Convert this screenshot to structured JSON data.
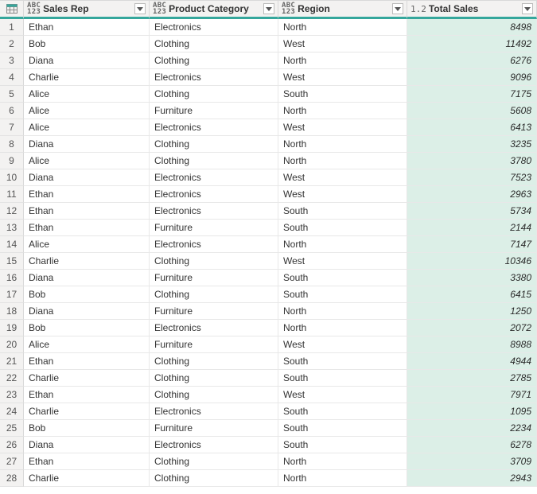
{
  "columns": [
    {
      "label": "Sales Rep",
      "type_top": "ABC",
      "type_bot": "123",
      "kind": "text"
    },
    {
      "label": "Product Category",
      "type_top": "ABC",
      "type_bot": "123",
      "kind": "text"
    },
    {
      "label": "Region",
      "type_top": "ABC",
      "type_bot": "123",
      "kind": "text"
    },
    {
      "label": "Total Sales",
      "type_num": "1.2",
      "kind": "num"
    }
  ],
  "rows": [
    {
      "n": "1",
      "rep": "Ethan",
      "cat": "Electronics",
      "reg": "North",
      "val": "8498"
    },
    {
      "n": "2",
      "rep": "Bob",
      "cat": "Clothing",
      "reg": "West",
      "val": "11492"
    },
    {
      "n": "3",
      "rep": "Diana",
      "cat": "Clothing",
      "reg": "North",
      "val": "6276"
    },
    {
      "n": "4",
      "rep": "Charlie",
      "cat": "Electronics",
      "reg": "West",
      "val": "9096"
    },
    {
      "n": "5",
      "rep": "Alice",
      "cat": "Clothing",
      "reg": "South",
      "val": "7175"
    },
    {
      "n": "6",
      "rep": "Alice",
      "cat": "Furniture",
      "reg": "North",
      "val": "5608"
    },
    {
      "n": "7",
      "rep": "Alice",
      "cat": "Electronics",
      "reg": "West",
      "val": "6413"
    },
    {
      "n": "8",
      "rep": "Diana",
      "cat": "Clothing",
      "reg": "North",
      "val": "3235"
    },
    {
      "n": "9",
      "rep": "Alice",
      "cat": "Clothing",
      "reg": "North",
      "val": "3780"
    },
    {
      "n": "10",
      "rep": "Diana",
      "cat": "Electronics",
      "reg": "West",
      "val": "7523"
    },
    {
      "n": "11",
      "rep": "Ethan",
      "cat": "Electronics",
      "reg": "West",
      "val": "2963"
    },
    {
      "n": "12",
      "rep": "Ethan",
      "cat": "Electronics",
      "reg": "South",
      "val": "5734"
    },
    {
      "n": "13",
      "rep": "Ethan",
      "cat": "Furniture",
      "reg": "South",
      "val": "2144"
    },
    {
      "n": "14",
      "rep": "Alice",
      "cat": "Electronics",
      "reg": "North",
      "val": "7147"
    },
    {
      "n": "15",
      "rep": "Charlie",
      "cat": "Clothing",
      "reg": "West",
      "val": "10346"
    },
    {
      "n": "16",
      "rep": "Diana",
      "cat": "Furniture",
      "reg": "South",
      "val": "3380"
    },
    {
      "n": "17",
      "rep": "Bob",
      "cat": "Clothing",
      "reg": "South",
      "val": "6415"
    },
    {
      "n": "18",
      "rep": "Diana",
      "cat": "Furniture",
      "reg": "North",
      "val": "1250"
    },
    {
      "n": "19",
      "rep": "Bob",
      "cat": "Electronics",
      "reg": "North",
      "val": "2072"
    },
    {
      "n": "20",
      "rep": "Alice",
      "cat": "Furniture",
      "reg": "West",
      "val": "8988"
    },
    {
      "n": "21",
      "rep": "Ethan",
      "cat": "Clothing",
      "reg": "South",
      "val": "4944"
    },
    {
      "n": "22",
      "rep": "Charlie",
      "cat": "Clothing",
      "reg": "South",
      "val": "2785"
    },
    {
      "n": "23",
      "rep": "Ethan",
      "cat": "Clothing",
      "reg": "West",
      "val": "7971"
    },
    {
      "n": "24",
      "rep": "Charlie",
      "cat": "Electronics",
      "reg": "South",
      "val": "1095"
    },
    {
      "n": "25",
      "rep": "Bob",
      "cat": "Furniture",
      "reg": "South",
      "val": "2234"
    },
    {
      "n": "26",
      "rep": "Diana",
      "cat": "Electronics",
      "reg": "South",
      "val": "6278"
    },
    {
      "n": "27",
      "rep": "Ethan",
      "cat": "Clothing",
      "reg": "North",
      "val": "3709"
    },
    {
      "n": "28",
      "rep": "Charlie",
      "cat": "Clothing",
      "reg": "North",
      "val": "2943"
    }
  ]
}
